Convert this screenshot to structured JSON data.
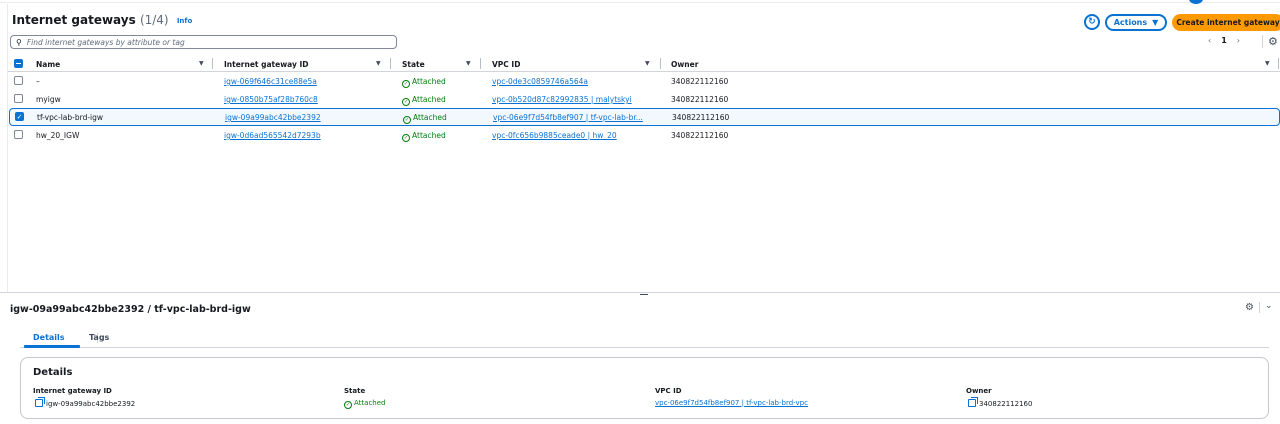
{
  "header": {
    "title": "Internet gateways",
    "count": "(1/4)",
    "info": "Info",
    "actions_label": "Actions",
    "create_label": "Create internet gateway"
  },
  "search": {
    "placeholder": "Find internet gateways by attribute or tag"
  },
  "pager": {
    "prev": "‹",
    "page": "1",
    "next": "›"
  },
  "columns": {
    "name": "Name",
    "igw": "Internet gateway ID",
    "state": "State",
    "vpc": "VPC ID",
    "owner": "Owner"
  },
  "rows": [
    {
      "name": "–",
      "igw": "igw-069f646c31ce88e5a",
      "state": "Attached",
      "vpc": "vpc-0de3c0859746a564a",
      "owner": "340822112160",
      "selected": false
    },
    {
      "name": "myigw",
      "igw": "igw-0850b75af28b760c8",
      "state": "Attached",
      "vpc": "vpc-0b520d87c82992835 | malytskyi",
      "owner": "340822112160",
      "selected": false
    },
    {
      "name": "tf-vpc-lab-brd-igw",
      "igw": "igw-09a99abc42bbe2392",
      "state": "Attached",
      "vpc": "vpc-06e9f7d54fb8ef907 | tf-vpc-lab-br...",
      "owner": "340822112160",
      "selected": true
    },
    {
      "name": "hw_20_IGW",
      "igw": "igw-0d6ad565542d7293b",
      "state": "Attached",
      "vpc": "vpc-0fc656b9885ceade0 | hw_20",
      "owner": "340822112160",
      "selected": false
    }
  ],
  "details": {
    "title": "igw-09a99abc42bbe2392 / tf-vpc-lab-brd-igw",
    "tabs": [
      "Details",
      "Tags"
    ],
    "card_title": "Details",
    "igw_label": "Internet gateway ID",
    "igw_value": "igw-09a99abc42bbe2392",
    "state_label": "State",
    "state_value": "Attached",
    "vpc_label": "VPC ID",
    "vpc_value": "vpc-06e9f7d54fb8ef907 | tf-vpc-lab-brd-vpc",
    "owner_label": "Owner",
    "owner_value": "340822112160"
  }
}
